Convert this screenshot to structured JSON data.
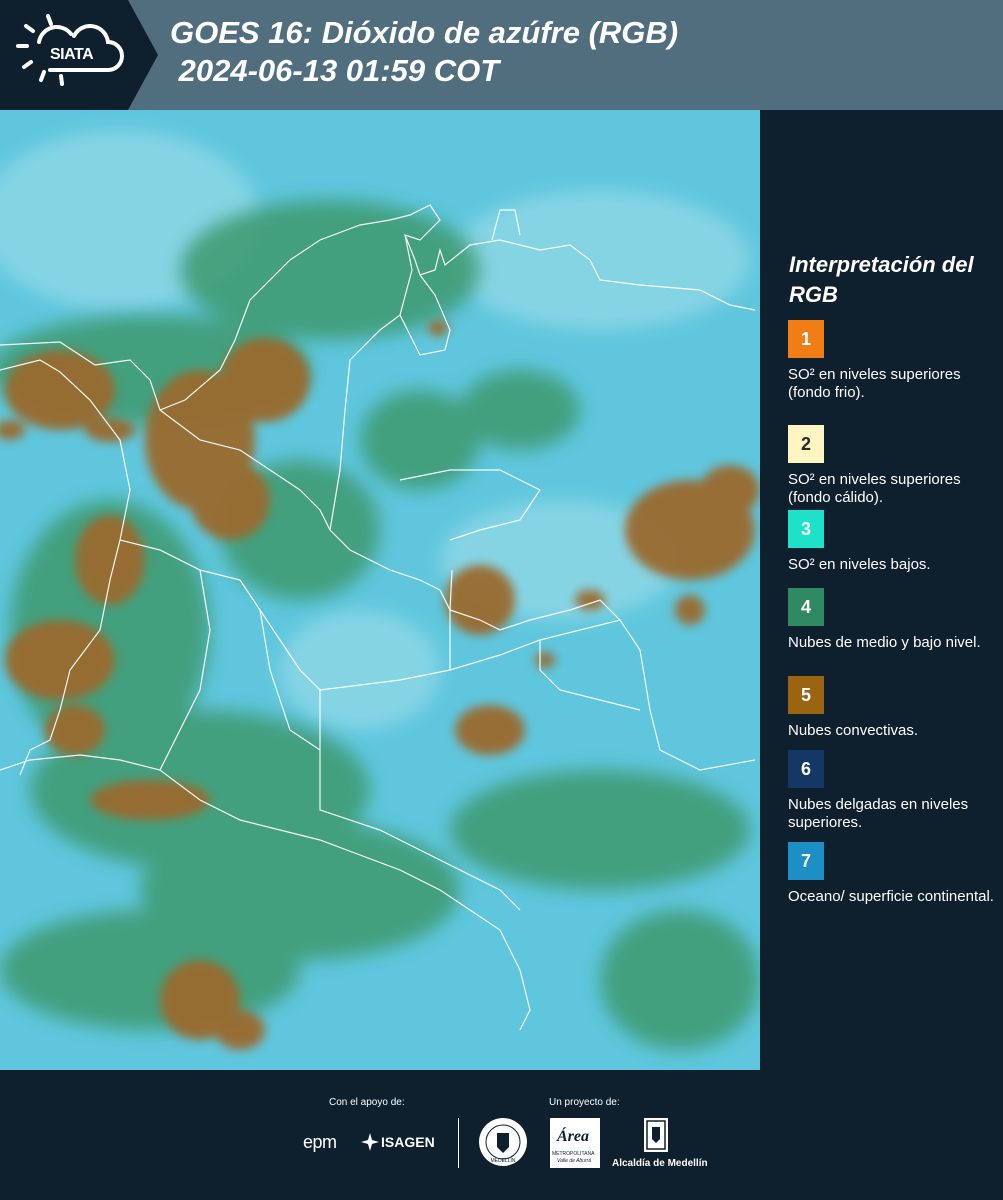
{
  "header": {
    "logo_text": "SIATA",
    "title_line1": "GOES 16: Dióxido de azúfre (RGB)",
    "title_line2": " 2024-06-13 01:59 COT"
  },
  "legend": {
    "title": "Interpretación del RGB",
    "items": [
      {
        "number": "1",
        "color": "#f07d16",
        "label": "SO² en niveles superiores (fondo frio)."
      },
      {
        "number": "2",
        "color": "#fdf6c3",
        "label": "SO² en niveles superiores (fondo cálido)."
      },
      {
        "number": "3",
        "color": "#1de1c9",
        "label": "SO² en niveles bajos."
      },
      {
        "number": "4",
        "color": "#2f8a63",
        "label": "Nubes de medio y bajo nivel."
      },
      {
        "number": "5",
        "color": "#9a6410",
        "label": "Nubes convectivas."
      },
      {
        "number": "6",
        "color": "#133866",
        "label": "Nubes delgadas en niveles superiores."
      },
      {
        "number": "7",
        "color": "#1b8fc6",
        "label": "Oceano/ superficie continental."
      }
    ]
  },
  "footer": {
    "support_label": "Con el apoyo de:",
    "project_label": "Un proyecto de:",
    "epm": "epm",
    "isagen": "ISAGEN",
    "area_brand": "Área",
    "area_sub": "METROPOLITANA",
    "area_sub2": "Valle de Aburrá",
    "alcaldia": "Alcaldía de Medellín",
    "seal_text": "MEDELLÍN"
  },
  "map": {
    "ocean_color": "#5fc6dd",
    "convective_color": "#9a6b2e",
    "low_cloud_color": "#2f8a63"
  }
}
